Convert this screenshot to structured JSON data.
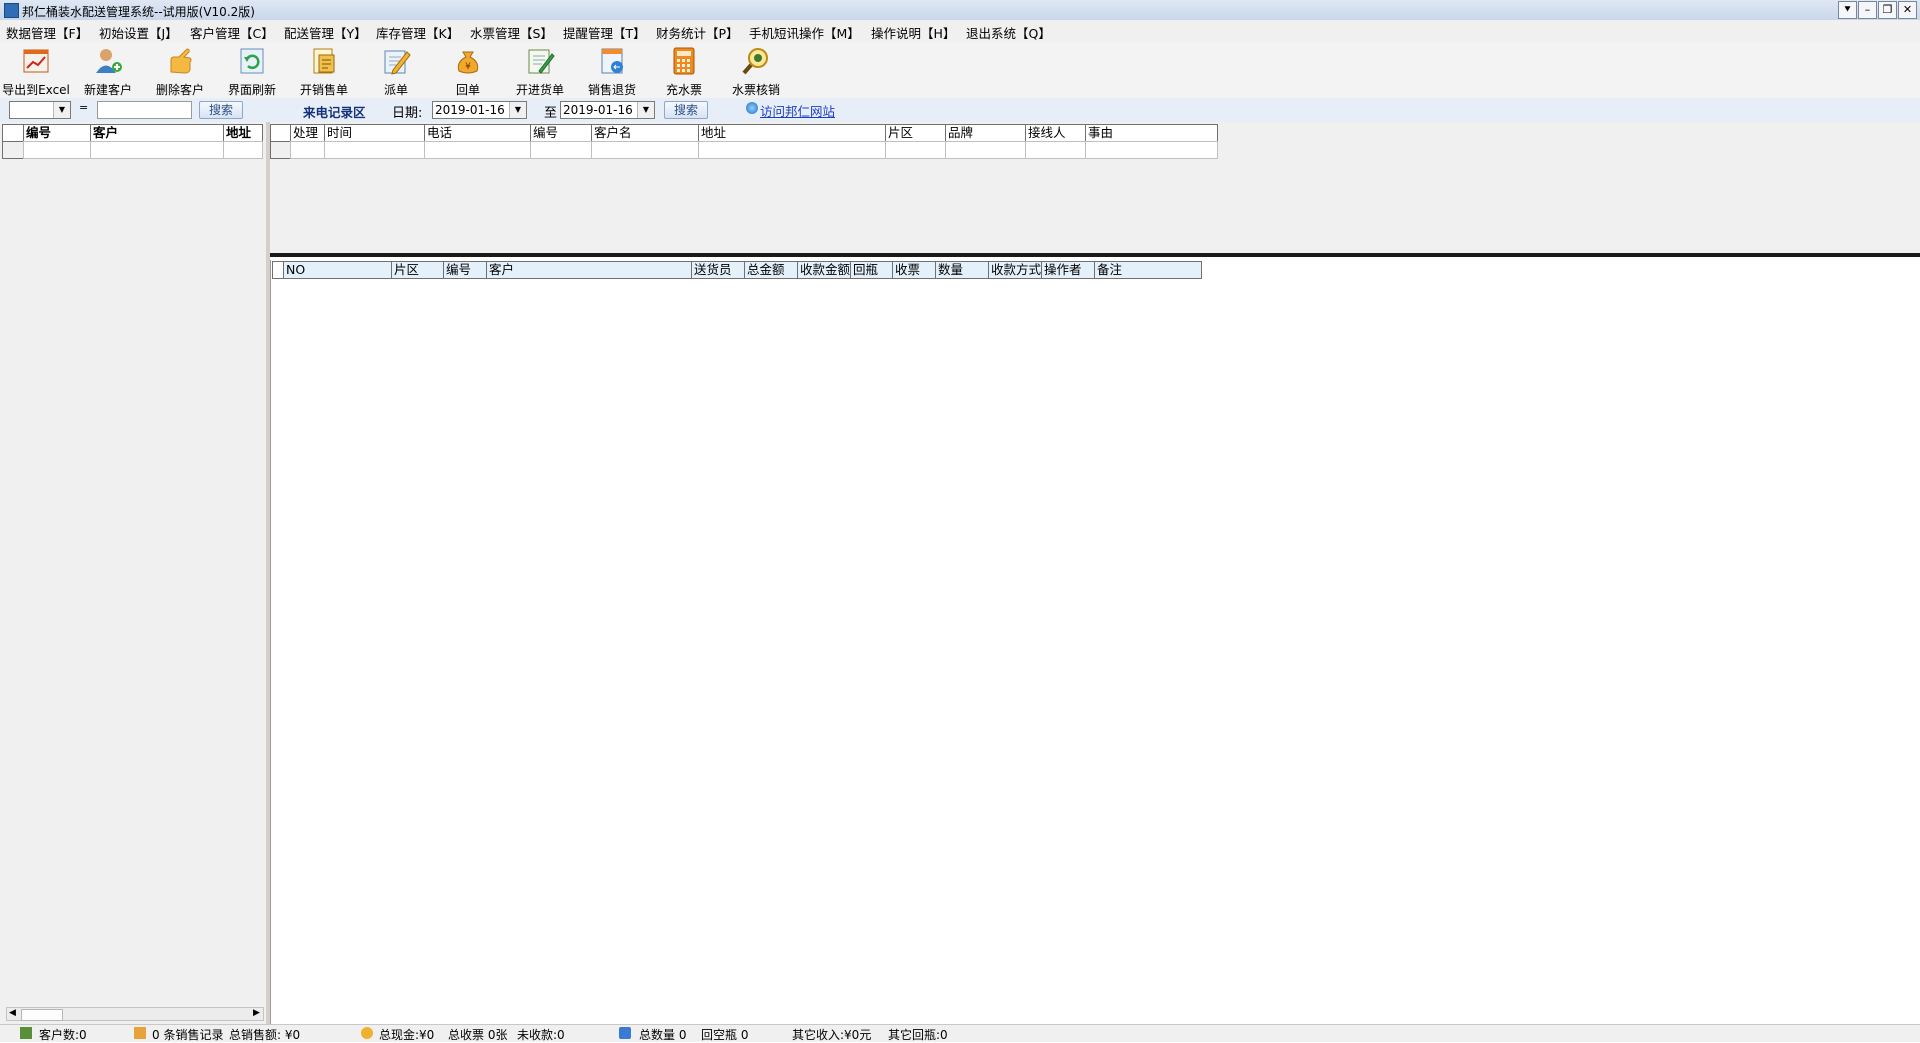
{
  "window": {
    "title": "邦仁桶装水配送管理系统--试用版(V10.2版)",
    "controls": [
      "⯆",
      "–",
      "❐",
      "✕"
    ]
  },
  "menu": [
    "数据管理【F】",
    "初始设置【J】",
    "客户管理【C】",
    "配送管理【Y】",
    "库存管理【K】",
    "水票管理【S】",
    "提醒管理【T】",
    "财务统计【P】",
    "手机短讯操作【M】",
    "操作说明【H】",
    "退出系统【Q】"
  ],
  "toolbar": [
    {
      "label": "导出到Excel",
      "icon": "excel-chart-icon"
    },
    {
      "label": "新建客户",
      "icon": "add-user-icon"
    },
    {
      "label": "删除客户",
      "icon": "hand-point-icon"
    },
    {
      "label": "界面刷新",
      "icon": "refresh-icon"
    },
    {
      "label": "开销售单",
      "icon": "sales-form-icon"
    },
    {
      "label": "派单",
      "icon": "pencil-note-icon"
    },
    {
      "label": "回单",
      "icon": "money-bag-icon"
    },
    {
      "label": "开进货单",
      "icon": "purchase-form-icon"
    },
    {
      "label": "销售退货",
      "icon": "return-icon"
    },
    {
      "label": "充水票",
      "icon": "calculator-icon"
    },
    {
      "label": "水票核销",
      "icon": "magnifier-icon"
    }
  ],
  "filter": {
    "left_combo_value": "",
    "equals": "=",
    "left_search_value": "",
    "left_search_button": "搜索",
    "call_area_label": "来电记录区",
    "date_label": "日期:",
    "date_from": "2019-01-16",
    "to_label": "至",
    "date_to": "2019-01-16",
    "search_button": "搜索",
    "visit_link": "访问邦仁网站"
  },
  "left_grid": {
    "columns": [
      "编号",
      "客户",
      "地址"
    ]
  },
  "call_grid": {
    "columns": [
      "处理",
      "时间",
      "电话",
      "编号",
      "客户名",
      "地址",
      "片区",
      "品牌",
      "接线人",
      "事由"
    ]
  },
  "sales_grid": {
    "columns": [
      "NO",
      "片区",
      "编号",
      "客户",
      "送货员",
      "总金额",
      "收款金额",
      "回瓶",
      "收票",
      "数量",
      "收款方式",
      "操作者",
      "备注"
    ]
  },
  "status": {
    "customer_count": "客户数:0",
    "sales_records": "0 条销售记录",
    "total_sales": "总销售额: ¥0",
    "total_cash": "总现金:¥0",
    "total_tickets": "总收票 0张",
    "unpaid": "未收款:0",
    "total_qty": "总数量 0",
    "empty_bottles": "回空瓶 0",
    "other_income": "其它收入:¥0元",
    "other_bottles": "其它回瓶:0"
  }
}
